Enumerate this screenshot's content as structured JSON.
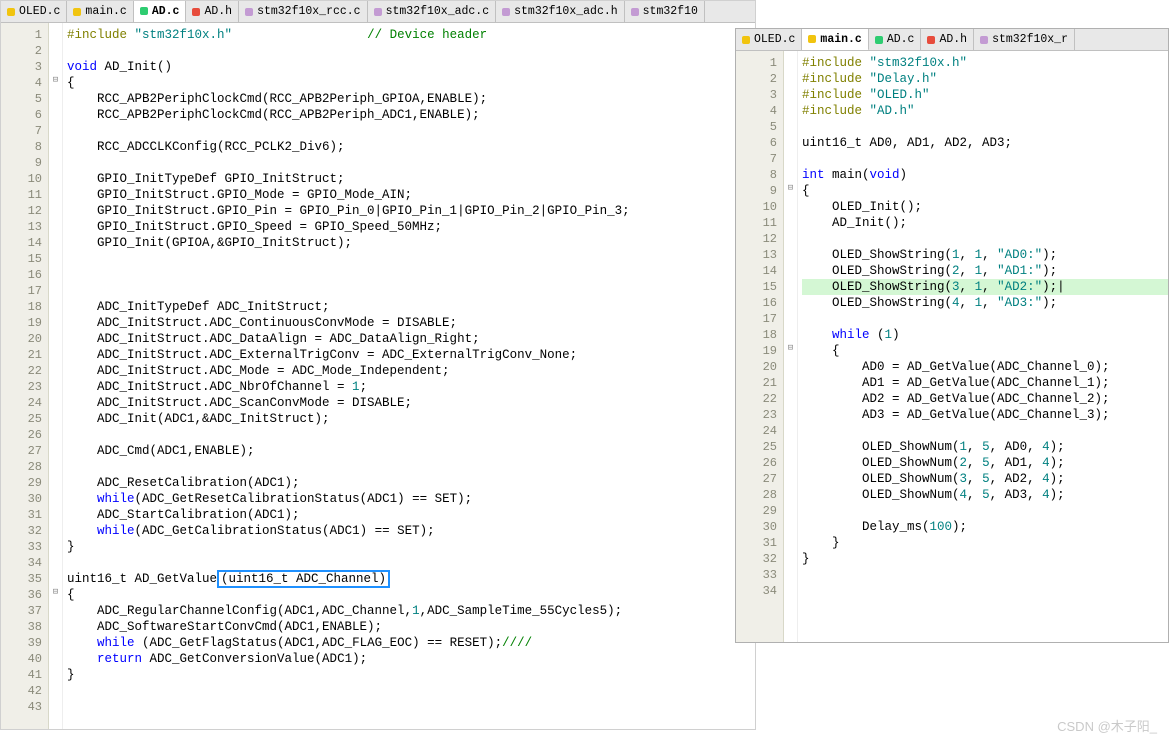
{
  "watermark": "CSDN @木子阳_",
  "left": {
    "tabs": [
      {
        "label": "OLED.c",
        "color": "yellow",
        "active": false
      },
      {
        "label": "main.c",
        "color": "yellow",
        "active": false
      },
      {
        "label": "AD.c",
        "color": "green",
        "active": true
      },
      {
        "label": "AD.h",
        "color": "red",
        "active": false
      },
      {
        "label": "stm32f10x_rcc.c",
        "color": "magenta",
        "active": false
      },
      {
        "label": "stm32f10x_adc.c",
        "color": "magenta",
        "active": false
      },
      {
        "label": "stm32f10x_adc.h",
        "color": "magenta",
        "active": false
      },
      {
        "label": "stm32f10",
        "color": "magenta",
        "active": false
      }
    ],
    "lines": [
      {
        "n": 1,
        "t": [
          [
            "pp",
            "#include "
          ],
          [
            "str",
            "\"stm32f10x.h\""
          ],
          [
            "id",
            "                  "
          ],
          [
            "cm",
            "// Device header"
          ]
        ]
      },
      {
        "n": 2,
        "t": [
          [
            "id",
            ""
          ]
        ]
      },
      {
        "n": 3,
        "t": [
          [
            "kw",
            "void"
          ],
          [
            "id",
            " AD_Init()"
          ]
        ]
      },
      {
        "n": 4,
        "t": [
          [
            "id",
            "{"
          ]
        ],
        "fold": "⊟"
      },
      {
        "n": 5,
        "t": [
          [
            "id",
            "    RCC_APB2PeriphClockCmd(RCC_APB2Periph_GPIOA,ENABLE);"
          ]
        ]
      },
      {
        "n": 6,
        "t": [
          [
            "id",
            "    RCC_APB2PeriphClockCmd(RCC_APB2Periph_ADC1,ENABLE);"
          ]
        ]
      },
      {
        "n": 7,
        "t": [
          [
            "id",
            ""
          ]
        ]
      },
      {
        "n": 8,
        "t": [
          [
            "id",
            "    RCC_ADCCLKConfig(RCC_PCLK2_Div6);"
          ]
        ]
      },
      {
        "n": 9,
        "t": [
          [
            "id",
            ""
          ]
        ]
      },
      {
        "n": 10,
        "t": [
          [
            "id",
            "    GPIO_InitTypeDef GPIO_InitStruct;"
          ]
        ]
      },
      {
        "n": 11,
        "t": [
          [
            "id",
            "    GPIO_InitStruct.GPIO_Mode = GPIO_Mode_AIN;"
          ]
        ]
      },
      {
        "n": 12,
        "t": [
          [
            "id",
            "    GPIO_InitStruct.GPIO_Pin = GPIO_Pin_0|GPIO_Pin_1|GPIO_Pin_2|GPIO_Pin_3;"
          ]
        ]
      },
      {
        "n": 13,
        "t": [
          [
            "id",
            "    GPIO_InitStruct.GPIO_Speed = GPIO_Speed_50MHz;"
          ]
        ]
      },
      {
        "n": 14,
        "t": [
          [
            "id",
            "    GPIO_Init(GPIOA,&GPIO_InitStruct);"
          ]
        ]
      },
      {
        "n": 15,
        "t": [
          [
            "id",
            ""
          ]
        ]
      },
      {
        "n": 16,
        "t": [
          [
            "id",
            ""
          ]
        ]
      },
      {
        "n": 17,
        "t": [
          [
            "id",
            ""
          ]
        ]
      },
      {
        "n": 18,
        "t": [
          [
            "id",
            "    ADC_InitTypeDef ADC_InitStruct;"
          ]
        ]
      },
      {
        "n": 19,
        "t": [
          [
            "id",
            "    ADC_InitStruct.ADC_ContinuousConvMode = DISABLE;"
          ]
        ]
      },
      {
        "n": 20,
        "t": [
          [
            "id",
            "    ADC_InitStruct.ADC_DataAlign = ADC_DataAlign_Right;"
          ]
        ]
      },
      {
        "n": 21,
        "t": [
          [
            "id",
            "    ADC_InitStruct.ADC_ExternalTrigConv = ADC_ExternalTrigConv_None;"
          ]
        ]
      },
      {
        "n": 22,
        "t": [
          [
            "id",
            "    ADC_InitStruct.ADC_Mode = ADC_Mode_Independent;"
          ]
        ]
      },
      {
        "n": 23,
        "t": [
          [
            "id",
            "    ADC_InitStruct.ADC_NbrOfChannel = "
          ],
          [
            "num",
            "1"
          ],
          [
            "id",
            ";"
          ]
        ]
      },
      {
        "n": 24,
        "t": [
          [
            "id",
            "    ADC_InitStruct.ADC_ScanConvMode = DISABLE;"
          ]
        ]
      },
      {
        "n": 25,
        "t": [
          [
            "id",
            "    ADC_Init(ADC1,&ADC_InitStruct);"
          ]
        ]
      },
      {
        "n": 26,
        "t": [
          [
            "id",
            ""
          ]
        ]
      },
      {
        "n": 27,
        "t": [
          [
            "id",
            "    ADC_Cmd(ADC1,ENABLE);"
          ]
        ]
      },
      {
        "n": 28,
        "t": [
          [
            "id",
            ""
          ]
        ]
      },
      {
        "n": 29,
        "t": [
          [
            "id",
            "    ADC_ResetCalibration(ADC1);"
          ]
        ]
      },
      {
        "n": 30,
        "t": [
          [
            "id",
            "    "
          ],
          [
            "kw",
            "while"
          ],
          [
            "id",
            "(ADC_GetResetCalibrationStatus(ADC1) == SET);"
          ]
        ]
      },
      {
        "n": 31,
        "t": [
          [
            "id",
            "    ADC_StartCalibration(ADC1);"
          ]
        ]
      },
      {
        "n": 32,
        "t": [
          [
            "id",
            "    "
          ],
          [
            "kw",
            "while"
          ],
          [
            "id",
            "(ADC_GetCalibrationStatus(ADC1) == SET);"
          ]
        ]
      },
      {
        "n": 33,
        "t": [
          [
            "id",
            "}"
          ]
        ]
      },
      {
        "n": 34,
        "t": [
          [
            "id",
            ""
          ]
        ]
      },
      {
        "n": 35,
        "t": [
          [
            "id",
            "uint16_t AD_GetValue"
          ],
          [
            "box",
            "(uint16_t ADC_Channel)"
          ]
        ]
      },
      {
        "n": 36,
        "t": [
          [
            "id",
            "{"
          ]
        ],
        "fold": "⊟"
      },
      {
        "n": 37,
        "t": [
          [
            "id",
            "    ADC_RegularChannelConfig(ADC1,ADC_Channel,"
          ],
          [
            "num",
            "1"
          ],
          [
            "id",
            ",ADC_SampleTime_55Cycles5);"
          ]
        ]
      },
      {
        "n": 38,
        "t": [
          [
            "id",
            "    ADC_SoftwareStartConvCmd(ADC1,ENABLE);"
          ]
        ]
      },
      {
        "n": 39,
        "t": [
          [
            "id",
            "    "
          ],
          [
            "kw",
            "while"
          ],
          [
            "id",
            " (ADC_GetFlagStatus(ADC1,ADC_FLAG_EOC) == RESET);"
          ],
          [
            "cm",
            "////"
          ]
        ]
      },
      {
        "n": 40,
        "t": [
          [
            "id",
            "    "
          ],
          [
            "kw",
            "return"
          ],
          [
            "id",
            " ADC_GetConversionValue(ADC1);"
          ]
        ]
      },
      {
        "n": 41,
        "t": [
          [
            "id",
            "}"
          ]
        ]
      },
      {
        "n": 42,
        "t": [
          [
            "id",
            ""
          ]
        ]
      },
      {
        "n": 43,
        "t": [
          [
            "id",
            ""
          ]
        ]
      }
    ]
  },
  "right": {
    "tabs": [
      {
        "label": "OLED.c",
        "color": "yellow",
        "active": false
      },
      {
        "label": "main.c",
        "color": "yellow",
        "active": true
      },
      {
        "label": "AD.c",
        "color": "green",
        "active": false
      },
      {
        "label": "AD.h",
        "color": "red",
        "active": false
      },
      {
        "label": "stm32f10x_r",
        "color": "magenta",
        "active": false
      }
    ],
    "lines": [
      {
        "n": 1,
        "t": [
          [
            "pp",
            "#include "
          ],
          [
            "str",
            "\"stm32f10x.h\""
          ]
        ]
      },
      {
        "n": 2,
        "t": [
          [
            "pp",
            "#include "
          ],
          [
            "str",
            "\"Delay.h\""
          ]
        ]
      },
      {
        "n": 3,
        "t": [
          [
            "pp",
            "#include "
          ],
          [
            "str",
            "\"OLED.h\""
          ]
        ]
      },
      {
        "n": 4,
        "t": [
          [
            "pp",
            "#include "
          ],
          [
            "str",
            "\"AD.h\""
          ]
        ]
      },
      {
        "n": 5,
        "t": [
          [
            "id",
            ""
          ]
        ]
      },
      {
        "n": 6,
        "t": [
          [
            "id",
            "uint16_t AD0, AD1, AD2, AD3;"
          ]
        ]
      },
      {
        "n": 7,
        "t": [
          [
            "id",
            ""
          ]
        ]
      },
      {
        "n": 8,
        "t": [
          [
            "kw",
            "int"
          ],
          [
            "id",
            " main("
          ],
          [
            "kw",
            "void"
          ],
          [
            "id",
            ")"
          ]
        ]
      },
      {
        "n": 9,
        "t": [
          [
            "id",
            "{"
          ]
        ],
        "fold": "⊟"
      },
      {
        "n": 10,
        "t": [
          [
            "id",
            "    OLED_Init();"
          ]
        ]
      },
      {
        "n": 11,
        "t": [
          [
            "id",
            "    AD_Init();"
          ]
        ]
      },
      {
        "n": 12,
        "t": [
          [
            "id",
            ""
          ]
        ]
      },
      {
        "n": 13,
        "t": [
          [
            "id",
            "    OLED_ShowString("
          ],
          [
            "num",
            "1"
          ],
          [
            "id",
            ", "
          ],
          [
            "num",
            "1"
          ],
          [
            "id",
            ", "
          ],
          [
            "str",
            "\"AD0:\""
          ],
          [
            "id",
            ");"
          ]
        ]
      },
      {
        "n": 14,
        "t": [
          [
            "id",
            "    OLED_ShowString("
          ],
          [
            "num",
            "2"
          ],
          [
            "id",
            ", "
          ],
          [
            "num",
            "1"
          ],
          [
            "id",
            ", "
          ],
          [
            "str",
            "\"AD1:\""
          ],
          [
            "id",
            ");"
          ]
        ]
      },
      {
        "n": 15,
        "hl": true,
        "t": [
          [
            "id",
            "    OLED_ShowString("
          ],
          [
            "num",
            "3"
          ],
          [
            "id",
            ", "
          ],
          [
            "num",
            "1"
          ],
          [
            "id",
            ", "
          ],
          [
            "str",
            "\"AD2:\""
          ],
          [
            "id",
            ");|"
          ]
        ]
      },
      {
        "n": 16,
        "t": [
          [
            "id",
            "    OLED_ShowString("
          ],
          [
            "num",
            "4"
          ],
          [
            "id",
            ", "
          ],
          [
            "num",
            "1"
          ],
          [
            "id",
            ", "
          ],
          [
            "str",
            "\"AD3:\""
          ],
          [
            "id",
            ");"
          ]
        ]
      },
      {
        "n": 17,
        "t": [
          [
            "id",
            ""
          ]
        ]
      },
      {
        "n": 18,
        "t": [
          [
            "id",
            "    "
          ],
          [
            "kw",
            "while"
          ],
          [
            "id",
            " ("
          ],
          [
            "num",
            "1"
          ],
          [
            "id",
            ")"
          ]
        ]
      },
      {
        "n": 19,
        "t": [
          [
            "id",
            "    {"
          ]
        ],
        "fold": "⊟"
      },
      {
        "n": 20,
        "t": [
          [
            "id",
            "        AD0 = AD_GetValue(ADC_Channel_0);"
          ]
        ]
      },
      {
        "n": 21,
        "t": [
          [
            "id",
            "        AD1 = AD_GetValue(ADC_Channel_1);"
          ]
        ]
      },
      {
        "n": 22,
        "t": [
          [
            "id",
            "        AD2 = AD_GetValue(ADC_Channel_2);"
          ]
        ]
      },
      {
        "n": 23,
        "t": [
          [
            "id",
            "        AD3 = AD_GetValue(ADC_Channel_3);"
          ]
        ]
      },
      {
        "n": 24,
        "t": [
          [
            "id",
            ""
          ]
        ]
      },
      {
        "n": 25,
        "t": [
          [
            "id",
            "        OLED_ShowNum("
          ],
          [
            "num",
            "1"
          ],
          [
            "id",
            ", "
          ],
          [
            "num",
            "5"
          ],
          [
            "id",
            ", AD0, "
          ],
          [
            "num",
            "4"
          ],
          [
            "id",
            ");"
          ]
        ]
      },
      {
        "n": 26,
        "t": [
          [
            "id",
            "        OLED_ShowNum("
          ],
          [
            "num",
            "2"
          ],
          [
            "id",
            ", "
          ],
          [
            "num",
            "5"
          ],
          [
            "id",
            ", AD1, "
          ],
          [
            "num",
            "4"
          ],
          [
            "id",
            ");"
          ]
        ]
      },
      {
        "n": 27,
        "t": [
          [
            "id",
            "        OLED_ShowNum("
          ],
          [
            "num",
            "3"
          ],
          [
            "id",
            ", "
          ],
          [
            "num",
            "5"
          ],
          [
            "id",
            ", AD2, "
          ],
          [
            "num",
            "4"
          ],
          [
            "id",
            ");"
          ]
        ]
      },
      {
        "n": 28,
        "t": [
          [
            "id",
            "        OLED_ShowNum("
          ],
          [
            "num",
            "4"
          ],
          [
            "id",
            ", "
          ],
          [
            "num",
            "5"
          ],
          [
            "id",
            ", AD3, "
          ],
          [
            "num",
            "4"
          ],
          [
            "id",
            ");"
          ]
        ]
      },
      {
        "n": 29,
        "t": [
          [
            "id",
            ""
          ]
        ]
      },
      {
        "n": 30,
        "t": [
          [
            "id",
            "        Delay_ms("
          ],
          [
            "num",
            "100"
          ],
          [
            "id",
            ");"
          ]
        ]
      },
      {
        "n": 31,
        "t": [
          [
            "id",
            "    }"
          ]
        ]
      },
      {
        "n": 32,
        "t": [
          [
            "id",
            "}"
          ]
        ]
      },
      {
        "n": 33,
        "t": [
          [
            "id",
            ""
          ]
        ]
      },
      {
        "n": 34,
        "t": [
          [
            "id",
            ""
          ]
        ]
      }
    ]
  }
}
